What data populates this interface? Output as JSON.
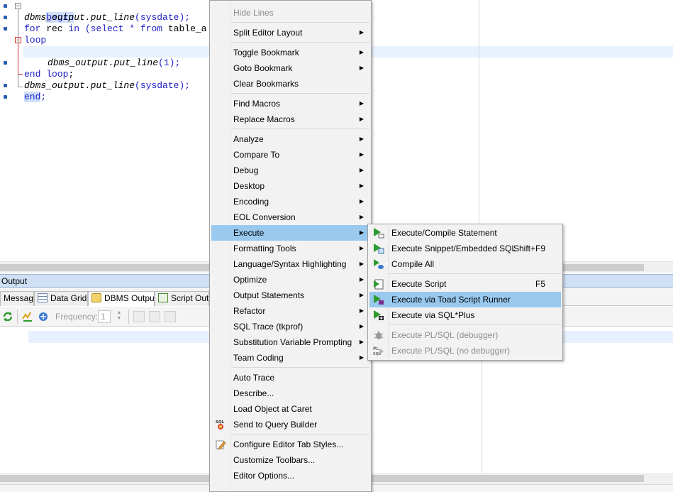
{
  "editor": {
    "lines": [
      {
        "text_kw": "begin"
      },
      {
        "fn": "dbms_output.put_line",
        "open": "(",
        "arg": "sysdate",
        "close": ");"
      },
      {
        "kw1": "for",
        "t1": " rec ",
        "kw2": "in",
        "t2": " (",
        "kw3": "select",
        "t3": " * ",
        "kw4": "from",
        "t4": " table_a"
      },
      {
        "kw": "loop"
      },
      {
        "fn": "dbms_output.put_line",
        "open": "(",
        "arg": "1",
        "close": ");"
      },
      {
        "kw": "end loop",
        "t": ";"
      },
      {
        "fn": "dbms_output.put_line",
        "open": "(",
        "arg": "sysdate",
        "close": ");"
      },
      {
        "kw": "end",
        "t": ";"
      }
    ]
  },
  "output": {
    "title": "Output",
    "tabs": [
      "Messages",
      "Data Grid",
      "DBMS Output",
      "Script Outp"
    ],
    "frequency_label": "Frequency:",
    "frequency_value": "1"
  },
  "context_menu": {
    "items": [
      {
        "label": "Hide Lines",
        "disabled": true
      },
      {
        "label": "Split Editor Layout",
        "submenu": true
      },
      {
        "label": "Toggle Bookmark",
        "submenu": true
      },
      {
        "label": "Goto Bookmark",
        "submenu": true
      },
      {
        "label": "Clear Bookmarks"
      },
      {
        "label": "Find Macros",
        "submenu": true
      },
      {
        "label": "Replace Macros",
        "submenu": true
      },
      {
        "label": "Analyze",
        "submenu": true
      },
      {
        "label": "Compare To",
        "submenu": true
      },
      {
        "label": "Debug",
        "submenu": true
      },
      {
        "label": "Desktop",
        "submenu": true
      },
      {
        "label": "Encoding",
        "submenu": true
      },
      {
        "label": "EOL Conversion",
        "submenu": true
      },
      {
        "label": "Execute",
        "submenu": true,
        "highlight": true
      },
      {
        "label": "Formatting Tools",
        "submenu": true
      },
      {
        "label": "Language/Syntax Highlighting",
        "submenu": true
      },
      {
        "label": "Optimize",
        "submenu": true
      },
      {
        "label": "Output Statements",
        "submenu": true
      },
      {
        "label": "Refactor",
        "submenu": true
      },
      {
        "label": "SQL Trace (tkprof)",
        "submenu": true
      },
      {
        "label": "Substitution Variable Prompting",
        "submenu": true
      },
      {
        "label": "Team Coding",
        "submenu": true
      },
      {
        "label": "Auto Trace"
      },
      {
        "label": "Describe..."
      },
      {
        "label": "Load Object at Caret"
      },
      {
        "label": "Send to Query Builder",
        "icon": "sql-icon"
      },
      {
        "label": "Configure Editor Tab Styles...",
        "icon": "pencil-icon"
      },
      {
        "label": "Customize Toolbars..."
      },
      {
        "label": "Editor Options..."
      }
    ]
  },
  "execute_submenu": {
    "items": [
      {
        "label": "Execute/Compile Statement",
        "icon": "execute-statement-icon"
      },
      {
        "label": "Execute Snippet/Embedded SQL",
        "shortcut": "Shift+F9",
        "icon": "execute-snippet-icon"
      },
      {
        "label": "Compile All",
        "icon": "compile-all-icon"
      },
      {
        "label": "Execute Script",
        "shortcut": "F5",
        "icon": "execute-script-icon"
      },
      {
        "label": "Execute via Toad Script Runner",
        "highlight": true,
        "icon": "toad-script-runner-icon"
      },
      {
        "label": "Execute via SQL*Plus",
        "icon": "sqlplus-icon"
      },
      {
        "label": "Execute PL/SQL (debugger)",
        "disabled": true,
        "icon": "debugger-icon"
      },
      {
        "label": "Execute PL/SQL (no debugger)",
        "disabled": true,
        "icon": "plsql-icon"
      }
    ]
  },
  "colors": {
    "keyword": "#2020c8",
    "highlight": "#99c9ef",
    "current_line": "#e8f2fe",
    "output_header": "#cfe0f5"
  }
}
